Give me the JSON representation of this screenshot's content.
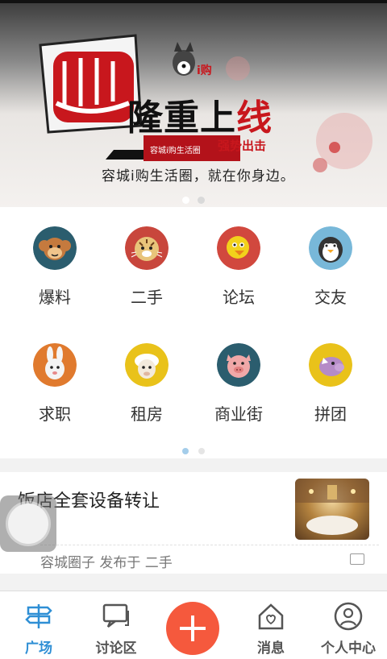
{
  "banner": {
    "headline_black": "隆重上",
    "headline_red": "线",
    "brand": "容城i购生活圈",
    "sub": "强势出击",
    "tagline": "容城i购生活圈，就在你身边。",
    "slide_count": 2,
    "active_slide": 1
  },
  "grid": {
    "items": [
      {
        "label": "爆料",
        "icon": "monkey-icon",
        "color": "#2b5d6e"
      },
      {
        "label": "二手",
        "icon": "tiger-icon",
        "color": "#c8463c"
      },
      {
        "label": "论坛",
        "icon": "chick-icon",
        "color": "#d1483e"
      },
      {
        "label": "交友",
        "icon": "penguin-icon",
        "color": "#78b8d9"
      },
      {
        "label": "求职",
        "icon": "rabbit-icon",
        "color": "#e07a2e"
      },
      {
        "label": "租房",
        "icon": "sheep-icon",
        "color": "#e9c21a"
      },
      {
        "label": "商业街",
        "icon": "pig-icon",
        "color": "#2b5d6e"
      },
      {
        "label": "拼团",
        "icon": "rhino-icon",
        "color": "#e9c21a"
      }
    ],
    "page_count": 2,
    "active_page": 1
  },
  "post": {
    "title": "饭店全套设备转让",
    "meta": "容城圈子 发布于 二手"
  },
  "tabbar": {
    "tabs": [
      {
        "label": "广场",
        "icon": "signpost-icon",
        "active": true
      },
      {
        "label": "讨论区",
        "icon": "chat-icon",
        "active": false
      },
      {
        "label": "",
        "icon": "plus-icon",
        "active": false
      },
      {
        "label": "消息",
        "icon": "home-heart-icon",
        "active": false
      },
      {
        "label": "个人中心",
        "icon": "user-icon",
        "active": false
      }
    ]
  },
  "colors": {
    "accent": "#2f8fd5",
    "plus_button": "#f5593d",
    "banner_red": "#c8171d"
  }
}
